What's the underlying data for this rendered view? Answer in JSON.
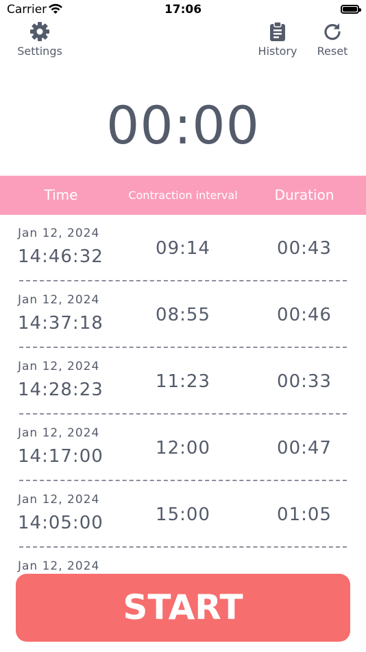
{
  "status_bar": {
    "carrier": "Carrier",
    "time": "17:06"
  },
  "nav": {
    "settings_label": "Settings",
    "history_label": "History",
    "reset_label": "Reset"
  },
  "timer": {
    "value": "00:00"
  },
  "table": {
    "headers": {
      "time": "Time",
      "interval": "Contraction interval",
      "duration": "Duration"
    },
    "rows": [
      {
        "date": "Jan 12, 2024",
        "time": "14:46:32",
        "interval": "09:14",
        "duration": "00:43"
      },
      {
        "date": "Jan 12, 2024",
        "time": "14:37:18",
        "interval": "08:55",
        "duration": "00:46"
      },
      {
        "date": "Jan 12, 2024",
        "time": "14:28:23",
        "interval": "11:23",
        "duration": "00:33"
      },
      {
        "date": "Jan 12, 2024",
        "time": "14:17:00",
        "interval": "12:00",
        "duration": "00:47"
      },
      {
        "date": "Jan 12, 2024",
        "time": "14:05:00",
        "interval": "15:00",
        "duration": "01:05"
      },
      {
        "date": "Jan 12, 2024"
      }
    ]
  },
  "start_button": {
    "label": "START"
  },
  "colors": {
    "header_bg": "#fb9ebc",
    "start_bg": "#f76e6e",
    "text": "#545b6b"
  }
}
